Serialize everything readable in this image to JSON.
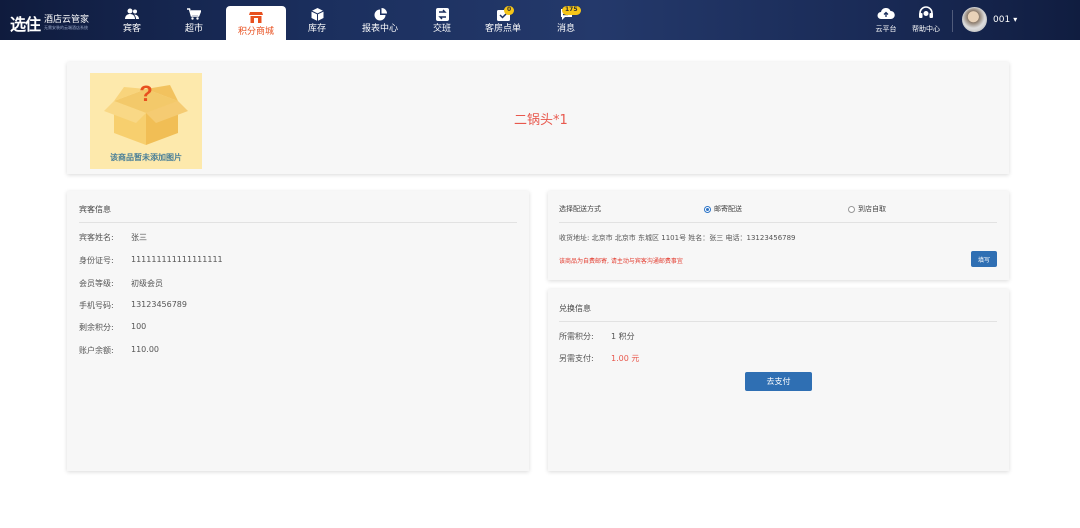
{
  "brand": {
    "logo": "选住",
    "name": "酒店云管家",
    "subtitle": "无需安装的云端酒店系统"
  },
  "nav": {
    "items": [
      {
        "label": "宾客",
        "icon": "users-icon"
      },
      {
        "label": "超市",
        "icon": "cart-icon"
      },
      {
        "label": "积分商城",
        "icon": "store-icon",
        "active": true
      },
      {
        "label": "库存",
        "icon": "box-icon"
      },
      {
        "label": "报表中心",
        "icon": "pie-chart-icon"
      },
      {
        "label": "交班",
        "icon": "exchange-icon"
      },
      {
        "label": "客房点单",
        "icon": "order-icon",
        "badge": "0"
      },
      {
        "label": "消息",
        "icon": "message-icon",
        "badge": "175"
      }
    ]
  },
  "tools": {
    "cloud": "云平台",
    "help": "帮助中心"
  },
  "user": {
    "name": "001"
  },
  "product": {
    "name": "二锅头*1",
    "no_image_text": "该商品暂未添加图片"
  },
  "guest": {
    "title": "宾客信息",
    "fields": [
      {
        "label": "宾客姓名:",
        "value": "张三"
      },
      {
        "label": "身份证号:",
        "value": "111111111111111111"
      },
      {
        "label": "会员等级:",
        "value": "初级会员"
      },
      {
        "label": "手机号码:",
        "value": "13123456789"
      },
      {
        "label": "剩余积分:",
        "value": "100"
      },
      {
        "label": "账户余额:",
        "value": "110.00"
      }
    ]
  },
  "shipping": {
    "title": "选择配送方式",
    "options": [
      "邮寄配送",
      "到店自取"
    ],
    "selected": "邮寄配送",
    "address": "收货地址:   北京市 北京市 东城区 1101号 姓名：张三 电话：13123456789",
    "note": "该商品为自费邮寄, 请主动与宾客沟通邮费事宜",
    "fill_button": "填写"
  },
  "exchange": {
    "title": "兑换信息",
    "points_label": "所需积分:",
    "points_value": "1 积分",
    "pay_label": "另需支付:",
    "pay_value": "1.00 元",
    "pay_button": "去支付"
  },
  "colors": {
    "accent": "#2f6fb3",
    "active_tab": "#e8501f",
    "price": "#e8584d",
    "note": "#e33b2e",
    "badge": "#f5c518"
  }
}
